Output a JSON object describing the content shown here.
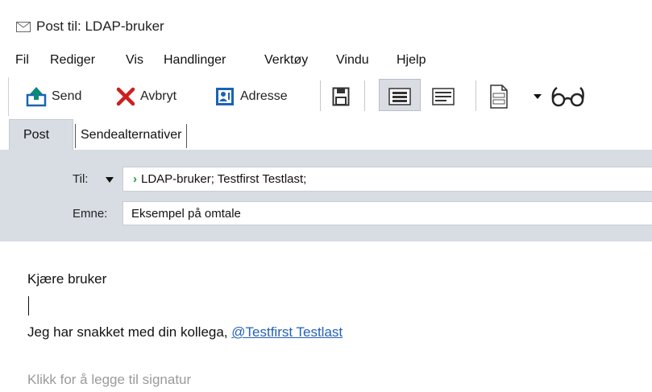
{
  "window": {
    "title": "Post til: LDAP-bruker"
  },
  "menu": [
    "Fil",
    "Rediger",
    "Vis",
    "Handlinger",
    "Verktøy",
    "Vindu",
    "Hjelp"
  ],
  "toolbar": {
    "send": "Send",
    "cancel": "Avbryt",
    "address": "Adresse"
  },
  "tabs": {
    "post": "Post",
    "send_options": "Sendealternativer"
  },
  "header": {
    "to_label": "Til:",
    "to_value": "LDAP-bruker;  Testfirst Testlast;",
    "subject_label": "Emne:",
    "subject_value": "Eksempel på omtale"
  },
  "body": {
    "greeting": "Kjære bruker",
    "text_prefix": "Jeg har snakket med din kollega, ",
    "mention": "@Testfirst  Testlast",
    "signature_hint": "Klikk for å legge til signatur"
  },
  "colors": {
    "header_bg": "#d7dde3",
    "mention": "#2460b8",
    "resolved_mark": "#1d9e36",
    "cancel_red": "#cc1f1f",
    "accent_blue": "#1a63b5"
  },
  "icons": [
    "envelope-icon",
    "send-icon",
    "cancel-x-icon",
    "address-book-icon",
    "save-floppy-icon",
    "format-rich-icon",
    "format-plain-icon",
    "template-icon",
    "dropdown-arrow-icon",
    "glasses-icon"
  ]
}
